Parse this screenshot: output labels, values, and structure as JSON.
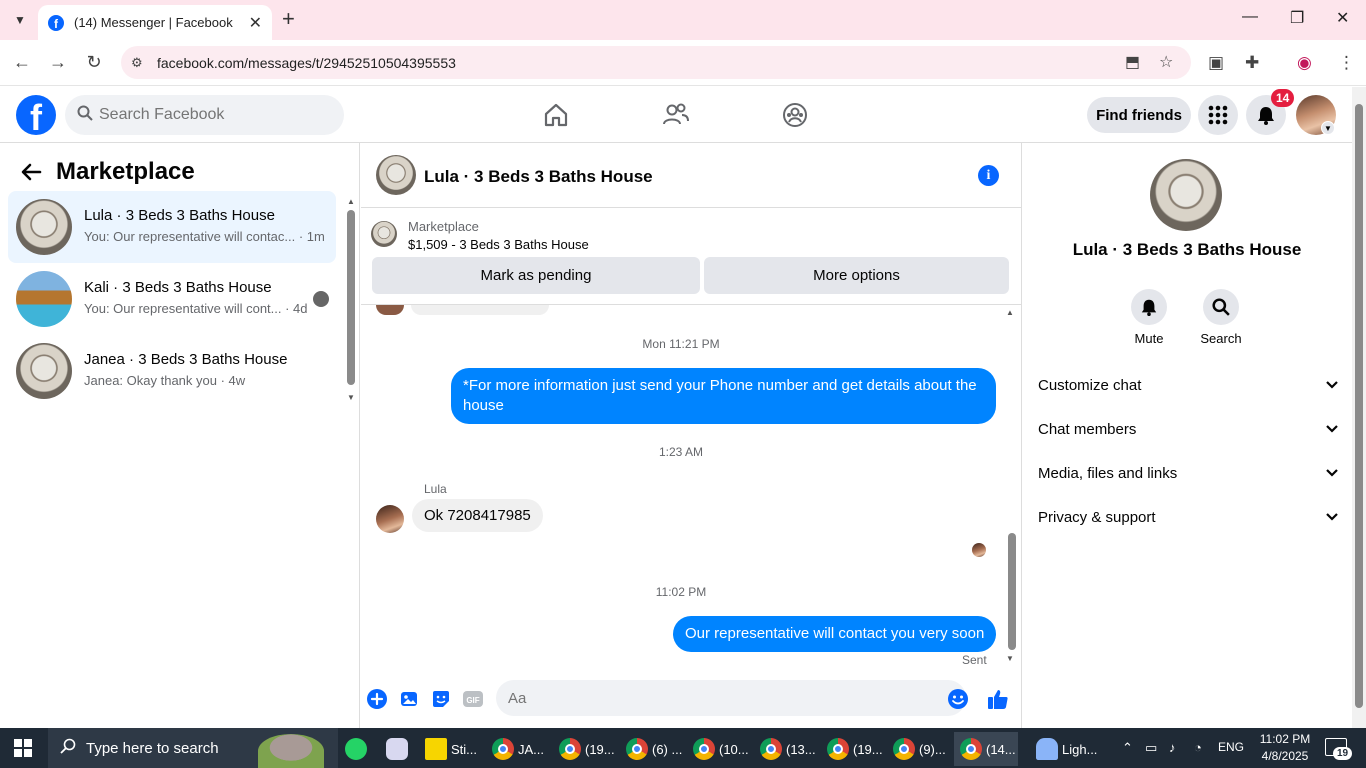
{
  "browser": {
    "tab_title": "(14) Messenger | Facebook",
    "url": "facebook.com/messages/t/29452510504395553",
    "close_tab": "✕",
    "new_tab": "+"
  },
  "header": {
    "search_placeholder": "Search Facebook",
    "find_friends": "Find friends",
    "notification_count": "14"
  },
  "sidebar": {
    "title": "Marketplace",
    "conversations": [
      {
        "name": "Lula · 3 Beds 3 Baths House",
        "snippet": "You: Our representative will contac... · 1m"
      },
      {
        "name": "Kali · 3 Beds 3 Baths House",
        "snippet": "You: Our representative will cont... · 4d"
      },
      {
        "name": "Janea · 3 Beds 3 Baths House",
        "snippet": "Janea: Okay thank you · 4w"
      }
    ]
  },
  "chat": {
    "title": "Lula · 3 Beds 3 Baths House",
    "listing_label": "Marketplace",
    "listing_price": "$1,509 - 3 Beds 3 Baths House",
    "mark_pending": "Mark as pending",
    "more_options": "More options",
    "messages": [
      {
        "time": "Mon 11:21 PM",
        "text": "*For more information just send your Phone number and  get details about the house"
      },
      {
        "time": "1:23 AM",
        "sender": "Lula",
        "text": "Ok 7208417985"
      },
      {
        "time": "11:02 PM",
        "text": "Our representative will contact you very soon"
      }
    ],
    "sent_status": "Sent",
    "composer_placeholder": "Aa"
  },
  "details": {
    "title": "Lula · 3 Beds 3 Baths House",
    "mute": "Mute",
    "search": "Search",
    "sections": [
      "Customize chat",
      "Chat members",
      "Media, files and links",
      "Privacy & support"
    ]
  },
  "taskbar": {
    "search_placeholder": "Type here to search",
    "apps": [
      "Sti...",
      "JA...",
      "(19...",
      "(6) ...",
      "(10...",
      "(13...",
      "(19...",
      "(9)...",
      "(14..."
    ],
    "weather": "Ligh...",
    "language": "ENG",
    "time": "11:02 PM",
    "date": "4/8/2025",
    "notification_count": "19"
  },
  "colors": {
    "facebook_blue": "#0866ff",
    "messenger_bubble": "#0084ff",
    "notification_red": "#e41e3f",
    "tabstrip_pink": "#fde5ec"
  }
}
